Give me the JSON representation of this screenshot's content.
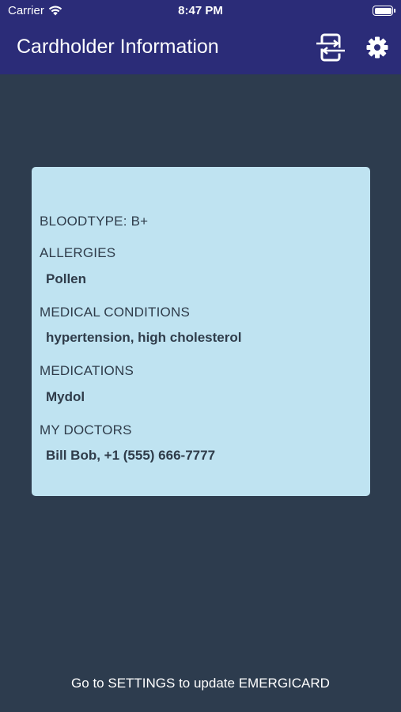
{
  "status_bar": {
    "carrier": "Carrier",
    "time": "8:47 PM"
  },
  "nav": {
    "title": "Cardholder Information",
    "switch_icon": "switch-card-icon",
    "settings_icon": "gear-icon"
  },
  "card": {
    "bloodtype": "BLOODTYPE: B+",
    "allergies_label": "ALLERGIES",
    "allergies_value": "Pollen",
    "conditions_label": "MEDICAL CONDITIONS",
    "conditions_value": "hypertension, high cholesterol",
    "medications_label": "MEDICATIONS",
    "medications_value": "Mydol",
    "doctors_label": "MY DOCTORS",
    "doctors_value": "Bill Bob, +1 (555) 666-7777"
  },
  "footer": {
    "text": "Go to SETTINGS to update EMERGICARD"
  },
  "colors": {
    "header": "#2b2c78",
    "background": "#2d3c4e",
    "card": "#bfe3f1",
    "text": "#2f3c4a"
  }
}
